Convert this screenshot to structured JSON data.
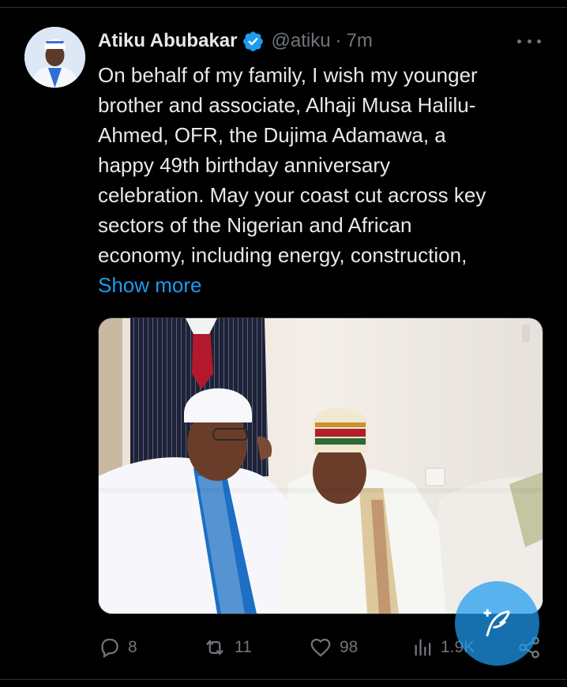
{
  "tweet": {
    "author_name": "Atiku Abubakar",
    "handle": "@atiku",
    "separator": "·",
    "time": "7m",
    "lines": [
      "On behalf of my family, I wish my younger",
      "brother and associate, Alhaji Musa Halilu-",
      "Ahmed, OFR, the Dujima Adamawa, a",
      "happy 49th birthday anniversary",
      "celebration. May your coast cut across key",
      "sectors of the Nigerian and African",
      "economy, including energy, construction,"
    ],
    "show_more": "Show more"
  },
  "actions": {
    "replies": "8",
    "reposts": "11",
    "likes": "98",
    "views": "1.9K"
  },
  "icons": {
    "verified": "verified-badge-icon",
    "more": "more-options-icon",
    "reply": "reply-icon",
    "repost": "repost-icon",
    "like": "heart-icon",
    "views": "analytics-icon",
    "share": "share-icon",
    "compose": "compose-feather-icon"
  },
  "colors": {
    "background": "#000000",
    "text": "#e7e9ea",
    "muted": "#71767b",
    "accent": "#1d9bf0",
    "divider": "#2f3336"
  }
}
